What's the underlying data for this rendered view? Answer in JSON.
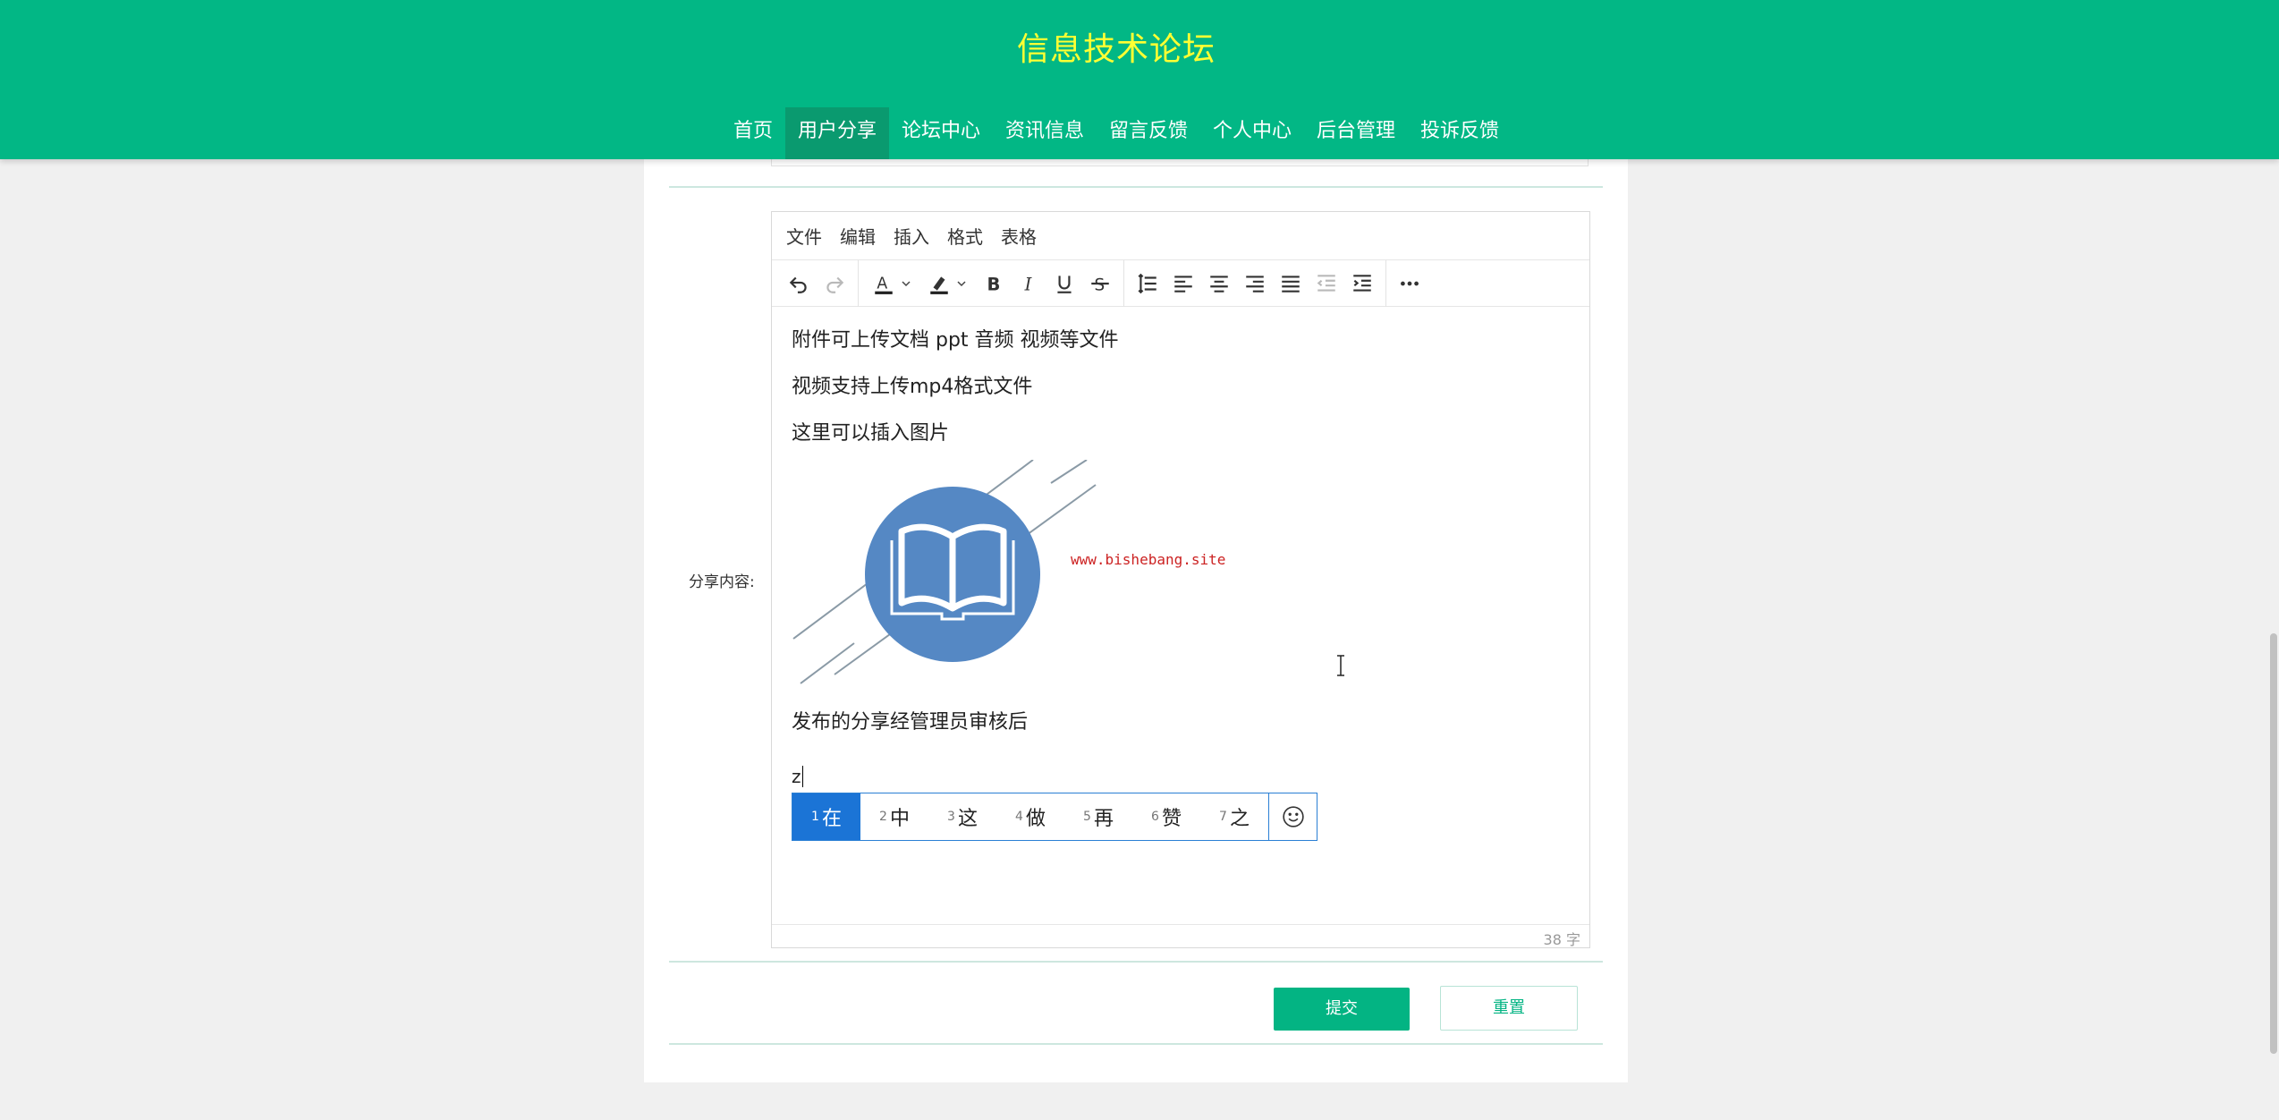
{
  "header": {
    "title": "信息技术论坛",
    "nav": [
      {
        "label": "首页",
        "name": "nav-home"
      },
      {
        "label": "用户分享",
        "name": "nav-user-share",
        "active": true
      },
      {
        "label": "论坛中心",
        "name": "nav-forum"
      },
      {
        "label": "资讯信息",
        "name": "nav-news"
      },
      {
        "label": "留言反馈",
        "name": "nav-message"
      },
      {
        "label": "个人中心",
        "name": "nav-profile"
      },
      {
        "label": "后台管理",
        "name": "nav-admin"
      },
      {
        "label": "投诉反馈",
        "name": "nav-complaint"
      }
    ]
  },
  "form": {
    "content_label": "分享内容:"
  },
  "editor": {
    "menu": [
      "文件",
      "编辑",
      "插入",
      "格式",
      "表格"
    ],
    "toolbar_icons": [
      "undo-icon",
      "redo-icon",
      "text-color-icon",
      "highlight-color-icon",
      "bold-icon",
      "italic-icon",
      "underline-icon",
      "strikethrough-icon",
      "line-height-icon",
      "align-left-icon",
      "align-center-icon",
      "align-right-icon",
      "align-justify-icon",
      "outdent-icon",
      "indent-icon",
      "more-icon"
    ],
    "paragraphs": [
      "附件可上传文档 ppt  音频 视频等文件",
      "视频支持上传mp4格式文件",
      "这里可以插入图片",
      "发布的分享经管理员审核后"
    ],
    "image_watermark": "www.bishebang.site",
    "typing": "z",
    "word_count": "38 字"
  },
  "ime": {
    "candidates": [
      {
        "num": "1",
        "char": "在"
      },
      {
        "num": "2",
        "char": "中"
      },
      {
        "num": "3",
        "char": "这"
      },
      {
        "num": "4",
        "char": "做"
      },
      {
        "num": "5",
        "char": "再"
      },
      {
        "num": "6",
        "char": "赞"
      },
      {
        "num": "7",
        "char": "之"
      }
    ],
    "emoji_icon": "smiley-icon"
  },
  "buttons": {
    "submit": "提交",
    "reset": "重置"
  },
  "colors": {
    "brand": "#02b785",
    "title": "#ffff33",
    "ime_selected": "#1b74d6",
    "logo_circle": "#5588c4",
    "watermark": "#cc2222"
  }
}
